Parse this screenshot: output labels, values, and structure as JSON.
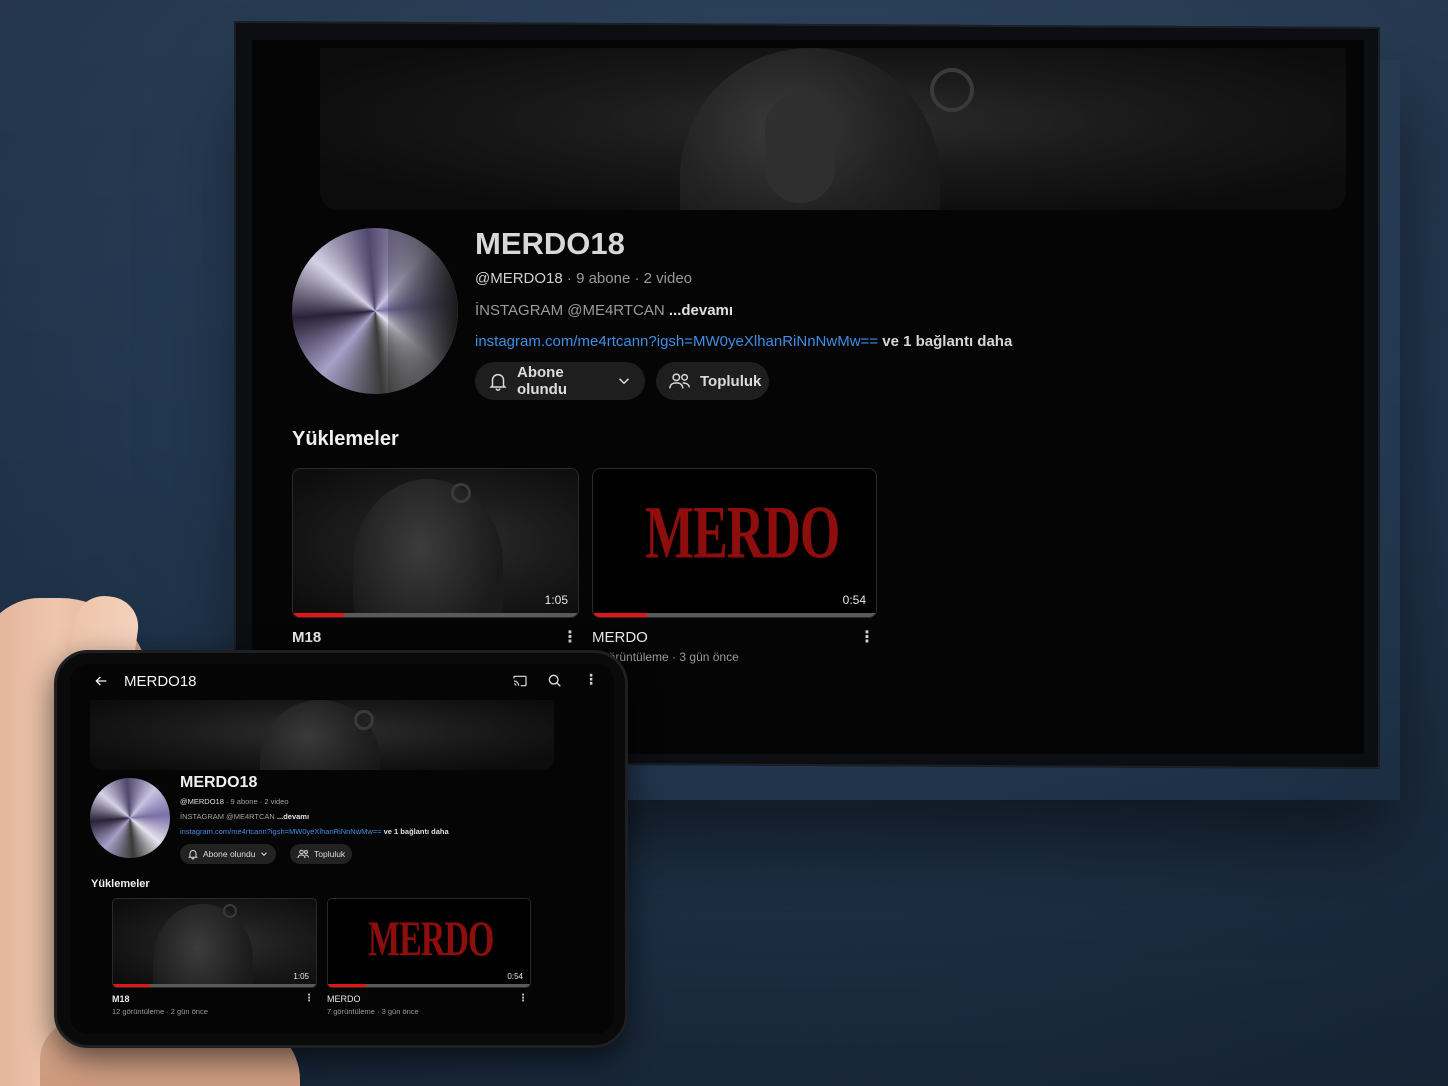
{
  "channel": {
    "name": "MERDO18",
    "handle": "@MERDO18",
    "stats": " · 9 abone · 2 video",
    "description": "İNSTAGRAM @ME4RTCAN ",
    "more_label": "...devamı",
    "link_url": "instagram.com/me4rtcann?igsh=MW0yeXlhanRiNnNwMw==",
    "link_more": " ve 1 bağlantı daha",
    "subscribed_label": "Abone olundu",
    "community_label": "Topluluk"
  },
  "uploads": {
    "section_title": "Yüklemeler",
    "videos": [
      {
        "title": "M18",
        "meta": "12 görüntüleme · 2 gün önce",
        "duration": "1:05",
        "progress": 0.18
      },
      {
        "title": "MERDO",
        "meta": "7 görüntüleme · 3 gün önce",
        "duration": "0:54",
        "progress": 0.19,
        "thumbnail_text": "MERDO"
      }
    ]
  },
  "phone": {
    "title": "MERDO18"
  },
  "colors": {
    "link": "#3f8ee6",
    "progress": "#e01616",
    "thumbnail_text": "#8e0d0d"
  },
  "icons": [
    "back-arrow-icon",
    "cast-icon",
    "search-icon",
    "more-vert-icon",
    "bell-icon",
    "chevron-down-icon",
    "community-icon"
  ]
}
